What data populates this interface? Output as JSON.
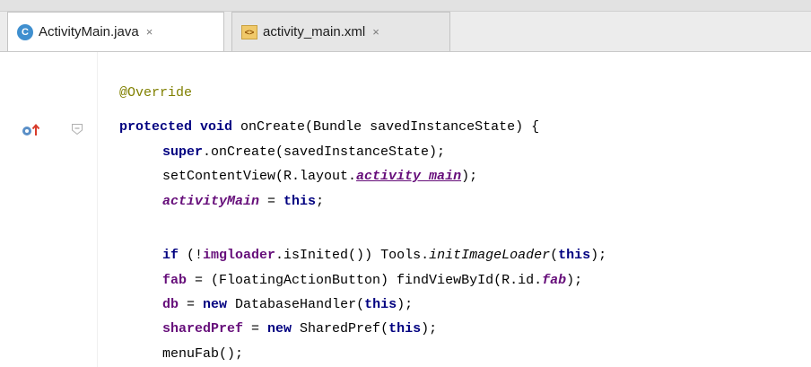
{
  "tabs": [
    {
      "label": "ActivityMain.java",
      "icon": "java-class-icon",
      "icon_text": "C",
      "close": "×",
      "active": true
    },
    {
      "label": "activity_main.xml",
      "icon": "xml-file-icon",
      "icon_text": "<>",
      "close": "×",
      "active": false
    }
  ],
  "editor": {
    "lines": {
      "l0": {
        "ann": "@Override"
      },
      "l1": {
        "kw1": "protected",
        "kw2": "void",
        "rest": " onCreate(Bundle savedInstanceState) {"
      },
      "l2": {
        "kw": "super",
        "rest": ".onCreate(savedInstanceState);"
      },
      "l3": {
        "a": "setContentView(R.layout.",
        "b": "activity_main",
        "c": ");"
      },
      "l4": {
        "a": "activityMain",
        "b": " = ",
        "c": "this",
        "d": ";"
      },
      "l5": {
        "kw": "if",
        "a": " (!",
        "b": "imgloader",
        "c": ".isInited()) Tools.",
        "d": "initImageLoader",
        "e": "(",
        "f": "this",
        "g": ");"
      },
      "l6": {
        "a": "fab",
        "b": " = (FloatingActionButton) findViewById(R.id.",
        "c": "fab",
        "d": ");"
      },
      "l7": {
        "a": "db",
        "b": " = ",
        "c": "new",
        "d": " DatabaseHandler(",
        "e": "this",
        "f": ");"
      },
      "l8": {
        "a": "sharedPref",
        "b": " = ",
        "c": "new",
        "d": " SharedPref(",
        "e": "this",
        "f": ");"
      },
      "l9": {
        "a": "menuFab();"
      }
    }
  },
  "colors": {
    "keyword": "#000080",
    "annotation": "#808000",
    "field": "#660e7a",
    "tab_bar": "#ececec"
  }
}
